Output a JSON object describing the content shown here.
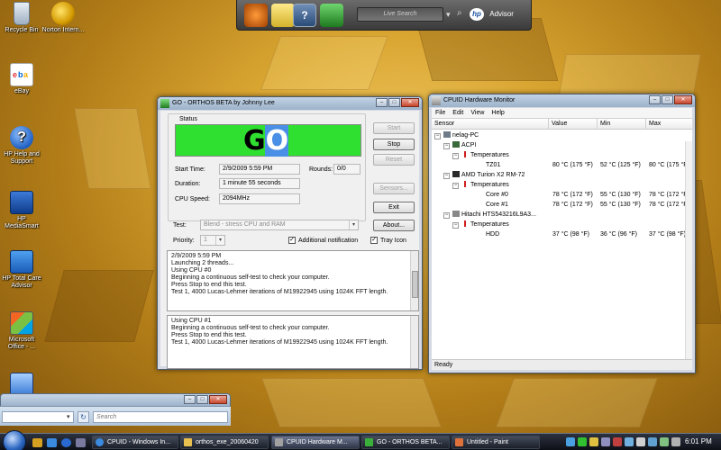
{
  "desktop": {
    "icons": [
      {
        "label": "Recycle Bin"
      },
      {
        "label": "Norton Intern..."
      },
      {
        "label": "eBay"
      },
      {
        "label": "HP Help and Support"
      },
      {
        "label": "HP MediaSmart"
      },
      {
        "label": "HP Total Care Advisor"
      },
      {
        "label": "Microsoft Office - ..."
      }
    ]
  },
  "top_toolbar": {
    "search_placeholder": "Live Search",
    "hp_logo_text": "hp",
    "advisor_label": "Advisor"
  },
  "orthos": {
    "title": "GO - ORTHOS BETA by Johnny Lee",
    "status_label": "Status",
    "go_text_g": "G",
    "go_text_o": "O",
    "start_time_label": "Start Time:",
    "start_time_value": "2/9/2009 5:59 PM",
    "rounds_label": "Rounds:",
    "rounds_value": "0/0",
    "duration_label": "Duration:",
    "duration_value": "1 minute 55 seconds",
    "cpu_speed_label": "CPU Speed:",
    "cpu_speed_value": "2094MHz",
    "buttons": {
      "start": "Start",
      "stop": "Stop",
      "reset": "Reset",
      "sensors": "Sensors...",
      "exit": "Exit",
      "about": "About..."
    },
    "test_label": "Test:",
    "test_value": "Blend - stress CPU and RAM",
    "priority_label": "Priority:",
    "priority_value": "1",
    "additional_notification": "Additional notification",
    "tray_icon": "Tray Icon",
    "log1": [
      "2/9/2009 5:59 PM",
      "Launching 2 threads...",
      "Using CPU #0",
      "Beginning a continuous self-test to check your computer.",
      "Press Stop to end this test.",
      "Test 1, 4000 Lucas-Lehmer iterations of M19922945 using 1024K FFT length."
    ],
    "log2": [
      "Using CPU #1",
      "Beginning a continuous self-test to check your computer.",
      "Press Stop to end this test.",
      "Test 1, 4000 Lucas-Lehmer iterations of M19922945 using 1024K FFT length."
    ]
  },
  "cpuid": {
    "title": "CPUID Hardware Monitor",
    "menu": [
      "File",
      "Edit",
      "View",
      "Help"
    ],
    "columns": [
      "Sensor",
      "Value",
      "Min",
      "Max"
    ],
    "rows": [
      {
        "name": "nelag-PC",
        "value": "",
        "min": "",
        "max": ""
      },
      {
        "name": "ACPI",
        "value": "",
        "min": "",
        "max": ""
      },
      {
        "name": "Temperatures",
        "value": "",
        "min": "",
        "max": ""
      },
      {
        "name": "TZ01",
        "value": "80 °C  (175 °F)",
        "min": "52 °C  (125 °F)",
        "max": "80 °C  (175 °F)"
      },
      {
        "name": "AMD Turion X2 RM-72",
        "value": "",
        "min": "",
        "max": ""
      },
      {
        "name": "Temperatures",
        "value": "",
        "min": "",
        "max": ""
      },
      {
        "name": "Core #0",
        "value": "78 °C  (172 °F)",
        "min": "55 °C  (130 °F)",
        "max": "78 °C  (172 °F)"
      },
      {
        "name": "Core #1",
        "value": "78 °C  (172 °F)",
        "min": "55 °C  (130 °F)",
        "max": "78 °C  (172 °F)"
      },
      {
        "name": "Hitachi HTS543216L9A3...",
        "value": "",
        "min": "",
        "max": ""
      },
      {
        "name": "Temperatures",
        "value": "",
        "min": "",
        "max": ""
      },
      {
        "name": "HDD",
        "value": "37 °C  (98 °F)",
        "min": "36 °C  (96 °F)",
        "max": "37 °C  (98 °F)"
      }
    ],
    "status": "Ready"
  },
  "explorer": {
    "search_placeholder": "Search"
  },
  "taskbar": {
    "tasks": [
      {
        "label": "CPUID - Windows In..."
      },
      {
        "label": "orthos_exe_20060420"
      },
      {
        "label": "CPUID Hardware M..."
      },
      {
        "label": "GO - ORTHOS BETA..."
      },
      {
        "label": "Untitled - Paint"
      }
    ],
    "clock": "6:01 PM"
  },
  "colors": {
    "go_green": "#30e030",
    "go_o_highlight": "#4a8fe6"
  }
}
